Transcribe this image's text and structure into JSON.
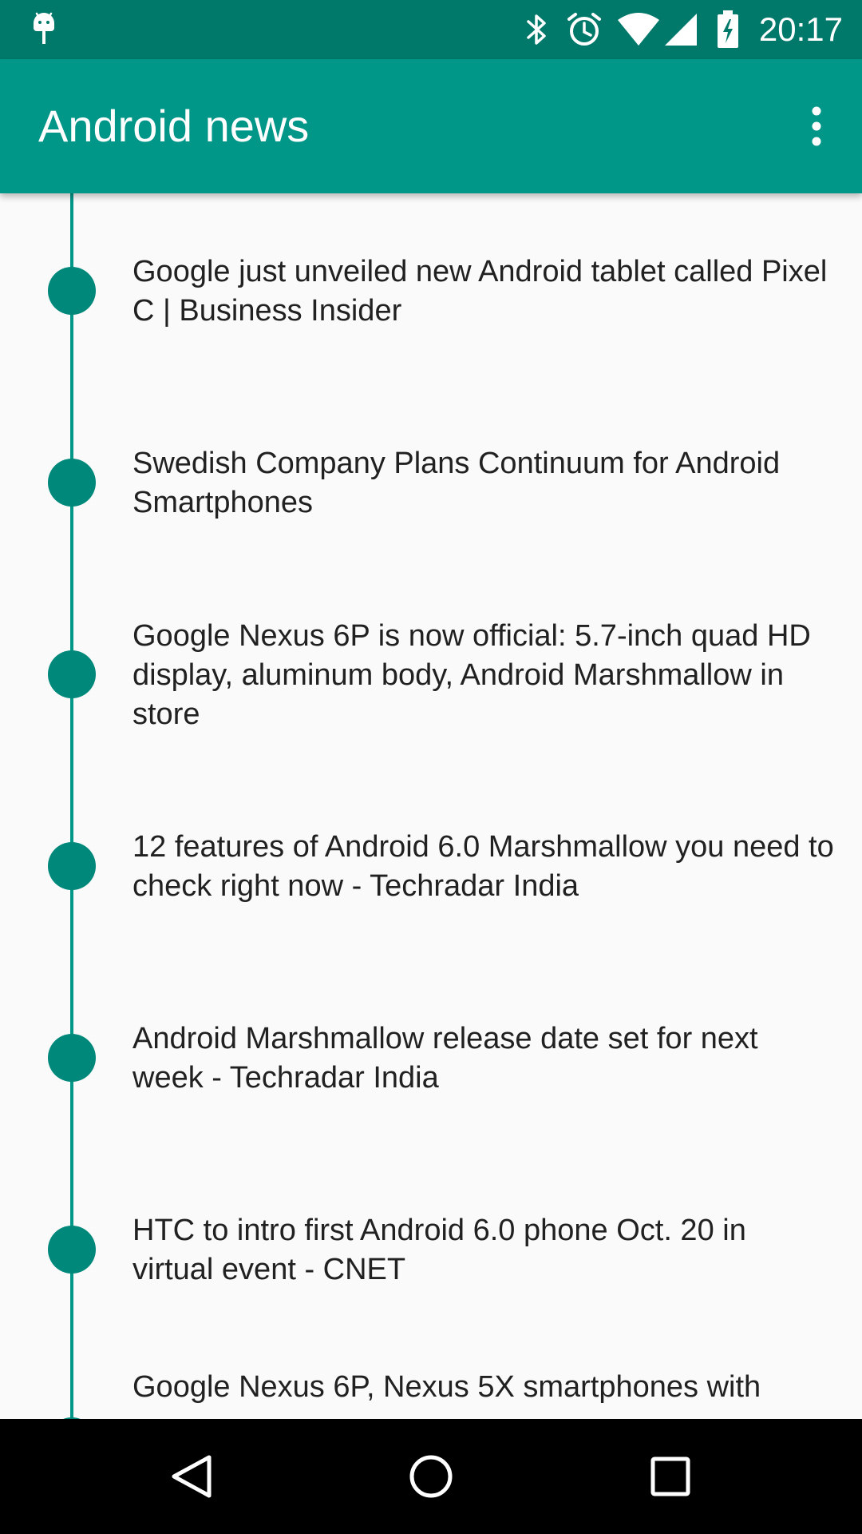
{
  "status_bar": {
    "time": "20:17",
    "icons": [
      "android-debug-icon",
      "bluetooth-icon",
      "alarm-icon",
      "wifi-icon",
      "cell-signal-icon",
      "battery-charging-icon"
    ]
  },
  "app_bar": {
    "title": "Android news",
    "menu_icon": "more-vert-icon"
  },
  "news": [
    {
      "title": "Google just unveiled new Android tablet called Pixel C | Business Insider"
    },
    {
      "title": "Swedish Company Plans Continuum for Android Smartphones"
    },
    {
      "title": "Google Nexus 6P is now official: 5.7-inch quad HD display, aluminum body, Android Marshmallow in store"
    },
    {
      "title": "12 features of Android 6.0 Marshmallow you need to check right now - Techradar India"
    },
    {
      "title": "Android Marshmallow release date set for next week - Techradar India"
    },
    {
      "title": "HTC to intro first Android 6.0 phone Oct. 20 in virtual event - CNET"
    },
    {
      "title": "Google Nexus 6P, Nexus 5X smartphones with"
    }
  ],
  "nav_bar": {
    "back_icon": "back-icon",
    "home_icon": "home-icon",
    "recents_icon": "recents-icon"
  },
  "colors": {
    "status_bar": "#00796b",
    "app_bar": "#009688",
    "timeline": "#009688",
    "dot": "#00897b",
    "text": "#212121"
  }
}
